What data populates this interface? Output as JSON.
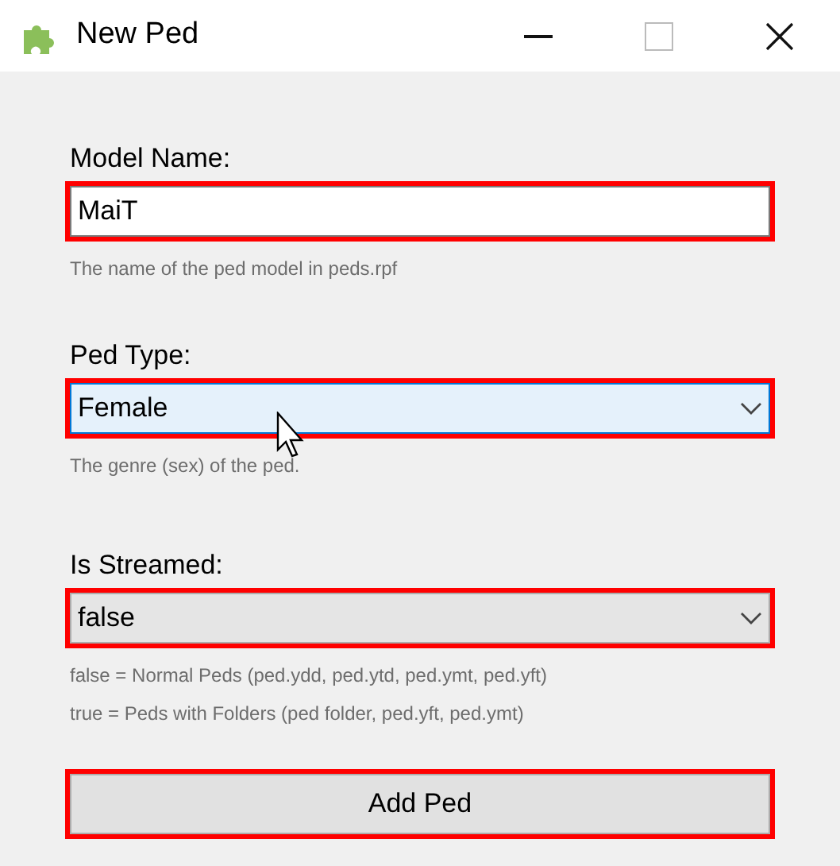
{
  "window": {
    "title": "New Ped"
  },
  "fields": [
    {
      "kind": "text",
      "label": "Model Name:",
      "value": "MaiT",
      "hint": "The name of the ped model in peds.rpf",
      "hovered": false,
      "highlighted": true
    },
    {
      "kind": "combo",
      "label": "Ped Type:",
      "value": "Female",
      "hint": "The genre (sex) of the ped.",
      "hovered": true,
      "highlighted": true
    },
    {
      "kind": "combo",
      "label": "Is Streamed:",
      "value": "false",
      "hint": "false = Normal Peds (ped.ydd, ped.ytd, ped.ymt, ped.yft)\ntrue = Peds with Folders (ped folder, ped.yft, ped.ymt)",
      "hovered": false,
      "highlighted": true
    }
  ],
  "button": {
    "label": "Add Ped",
    "highlighted": true
  }
}
